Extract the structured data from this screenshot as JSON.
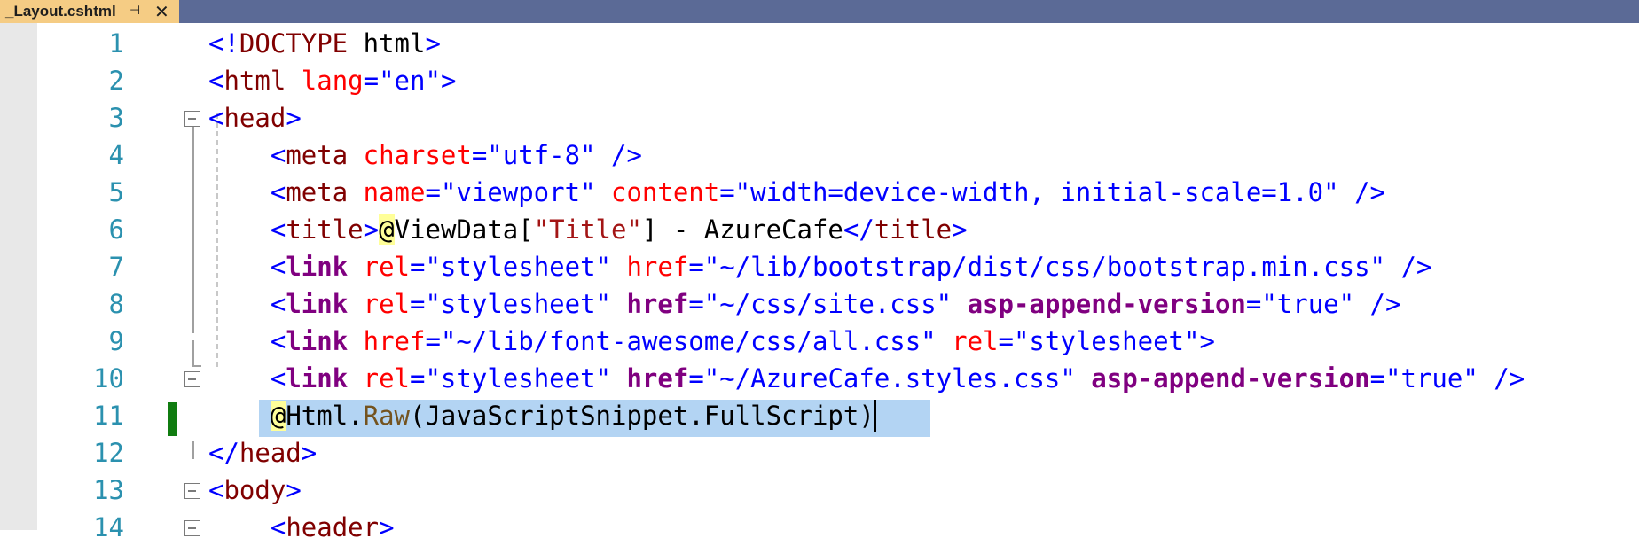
{
  "tab": {
    "title": "_Layout.cshtml",
    "pin_icon": "pin-icon",
    "close_icon": "close-icon"
  },
  "editor": {
    "lines": [
      {
        "number": "1",
        "tokens": [
          {
            "t": "<!",
            "c": "del"
          },
          {
            "t": "DOCTYPE",
            "c": "tag"
          },
          {
            "t": " ",
            "c": "def"
          },
          {
            "t": "html",
            "c": "def"
          },
          {
            "t": ">",
            "c": "del"
          }
        ]
      },
      {
        "number": "2",
        "tokens": [
          {
            "t": "<",
            "c": "del"
          },
          {
            "t": "html",
            "c": "tag"
          },
          {
            "t": " ",
            "c": "def"
          },
          {
            "t": "lang",
            "c": "attr"
          },
          {
            "t": "=\"en\"",
            "c": "val"
          },
          {
            "t": ">",
            "c": "del"
          }
        ]
      },
      {
        "number": "3",
        "tokens": [
          {
            "t": "<",
            "c": "del"
          },
          {
            "t": "head",
            "c": "tag"
          },
          {
            "t": ">",
            "c": "del"
          }
        ]
      },
      {
        "number": "4",
        "tokens": [
          {
            "t": "    ",
            "c": "def"
          },
          {
            "t": "<",
            "c": "del"
          },
          {
            "t": "meta",
            "c": "tag"
          },
          {
            "t": " ",
            "c": "def"
          },
          {
            "t": "charset",
            "c": "attr"
          },
          {
            "t": "=\"utf-8\"",
            "c": "val"
          },
          {
            "t": " />",
            "c": "del"
          }
        ]
      },
      {
        "number": "5",
        "tokens": [
          {
            "t": "    ",
            "c": "def"
          },
          {
            "t": "<",
            "c": "del"
          },
          {
            "t": "meta",
            "c": "tag"
          },
          {
            "t": " ",
            "c": "def"
          },
          {
            "t": "name",
            "c": "attr"
          },
          {
            "t": "=\"viewport\"",
            "c": "val"
          },
          {
            "t": " ",
            "c": "def"
          },
          {
            "t": "content",
            "c": "attr"
          },
          {
            "t": "=\"width=device-width, initial-scale=1.0\"",
            "c": "val"
          },
          {
            "t": " />",
            "c": "del"
          }
        ]
      },
      {
        "number": "6",
        "tokens": [
          {
            "t": "    ",
            "c": "def"
          },
          {
            "t": "<",
            "c": "del"
          },
          {
            "t": "title",
            "c": "tag"
          },
          {
            "t": ">",
            "c": "del"
          },
          {
            "t": "@",
            "c": "razor"
          },
          {
            "t": "ViewData[",
            "c": "def"
          },
          {
            "t": "\"Title\"",
            "c": "string"
          },
          {
            "t": "] - AzureCafe",
            "c": "def"
          },
          {
            "t": "</",
            "c": "del"
          },
          {
            "t": "title",
            "c": "tag"
          },
          {
            "t": ">",
            "c": "del"
          }
        ]
      },
      {
        "number": "7",
        "tokens": [
          {
            "t": "    ",
            "c": "def"
          },
          {
            "t": "<",
            "c": "del"
          },
          {
            "t": "link",
            "c": "th-tag"
          },
          {
            "t": " ",
            "c": "def"
          },
          {
            "t": "rel",
            "c": "attr"
          },
          {
            "t": "=\"stylesheet\"",
            "c": "val"
          },
          {
            "t": " ",
            "c": "def"
          },
          {
            "t": "href",
            "c": "attr"
          },
          {
            "t": "=\"~/lib/bootstrap/dist/css/bootstrap.min.css\"",
            "c": "val"
          },
          {
            "t": " />",
            "c": "del"
          }
        ]
      },
      {
        "number": "8",
        "tokens": [
          {
            "t": "    ",
            "c": "def"
          },
          {
            "t": "<",
            "c": "del"
          },
          {
            "t": "link",
            "c": "th-tag"
          },
          {
            "t": " ",
            "c": "def"
          },
          {
            "t": "rel",
            "c": "attr"
          },
          {
            "t": "=\"stylesheet\"",
            "c": "val"
          },
          {
            "t": " ",
            "c": "def"
          },
          {
            "t": "href",
            "c": "th-attr"
          },
          {
            "t": "=\"~/css/site.css\"",
            "c": "val"
          },
          {
            "t": " ",
            "c": "def"
          },
          {
            "t": "asp-append-version",
            "c": "th-attr"
          },
          {
            "t": "=\"true\"",
            "c": "val"
          },
          {
            "t": " />",
            "c": "del"
          }
        ]
      },
      {
        "number": "9",
        "tokens": [
          {
            "t": "    ",
            "c": "def"
          },
          {
            "t": "<",
            "c": "del"
          },
          {
            "t": "link",
            "c": "th-tag"
          },
          {
            "t": " ",
            "c": "def"
          },
          {
            "t": "href",
            "c": "attr"
          },
          {
            "t": "=\"~/lib/font-awesome/css/all.css\"",
            "c": "val"
          },
          {
            "t": " ",
            "c": "def"
          },
          {
            "t": "rel",
            "c": "attr"
          },
          {
            "t": "=\"stylesheet\"",
            "c": "val"
          },
          {
            "t": ">",
            "c": "del"
          }
        ]
      },
      {
        "number": "10",
        "tokens": [
          {
            "t": "    ",
            "c": "def"
          },
          {
            "t": "<",
            "c": "del"
          },
          {
            "t": "link",
            "c": "th-tag"
          },
          {
            "t": " ",
            "c": "def"
          },
          {
            "t": "rel",
            "c": "attr"
          },
          {
            "t": "=\"stylesheet\"",
            "c": "val"
          },
          {
            "t": " ",
            "c": "def"
          },
          {
            "t": "href",
            "c": "th-attr"
          },
          {
            "t": "=\"~/AzureCafe.styles.css\"",
            "c": "val"
          },
          {
            "t": " ",
            "c": "def"
          },
          {
            "t": "asp-append-version",
            "c": "th-attr"
          },
          {
            "t": "=\"true\"",
            "c": "val"
          },
          {
            "t": " />",
            "c": "del"
          }
        ]
      },
      {
        "number": "11",
        "tokens": [
          {
            "t": "    ",
            "c": "def"
          },
          {
            "t": "@",
            "c": "razor"
          },
          {
            "t": "Html.",
            "c": "def"
          },
          {
            "t": "Raw",
            "c": "method"
          },
          {
            "t": "(JavaScriptSnippet.FullScript)",
            "c": "def"
          }
        ]
      },
      {
        "number": "12",
        "tokens": [
          {
            "t": "</",
            "c": "del"
          },
          {
            "t": "head",
            "c": "tag"
          },
          {
            "t": ">",
            "c": "del"
          }
        ]
      },
      {
        "number": "13",
        "tokens": [
          {
            "t": "<",
            "c": "del"
          },
          {
            "t": "body",
            "c": "tag"
          },
          {
            "t": ">",
            "c": "del"
          }
        ]
      },
      {
        "number": "14",
        "tokens": [
          {
            "t": "    ",
            "c": "def"
          },
          {
            "t": "<",
            "c": "del"
          },
          {
            "t": "header",
            "c": "tag"
          },
          {
            "t": ">",
            "c": "del"
          }
        ]
      }
    ]
  }
}
